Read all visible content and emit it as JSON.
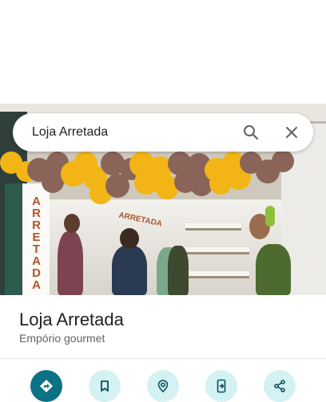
{
  "search": {
    "query": "Loja Arretada"
  },
  "place": {
    "name": "Loja Arretada",
    "category": "Empório gourmet"
  },
  "photo": {
    "sign_text": "ARRETADA",
    "interior_sign_text": "ARRETADA"
  },
  "actions": [
    {
      "icon": "directions-icon"
    },
    {
      "icon": "bookmark-icon"
    },
    {
      "icon": "nearby-icon"
    },
    {
      "icon": "send-to-phone-icon"
    },
    {
      "icon": "share-icon"
    }
  ],
  "colors": {
    "primary_action": "#0b7285",
    "secondary_action_bg": "#d4f1f4",
    "icon_dark": "#0b4f5c",
    "balloon_yellow": "#f2b515",
    "balloon_brown": "#8b6459"
  }
}
